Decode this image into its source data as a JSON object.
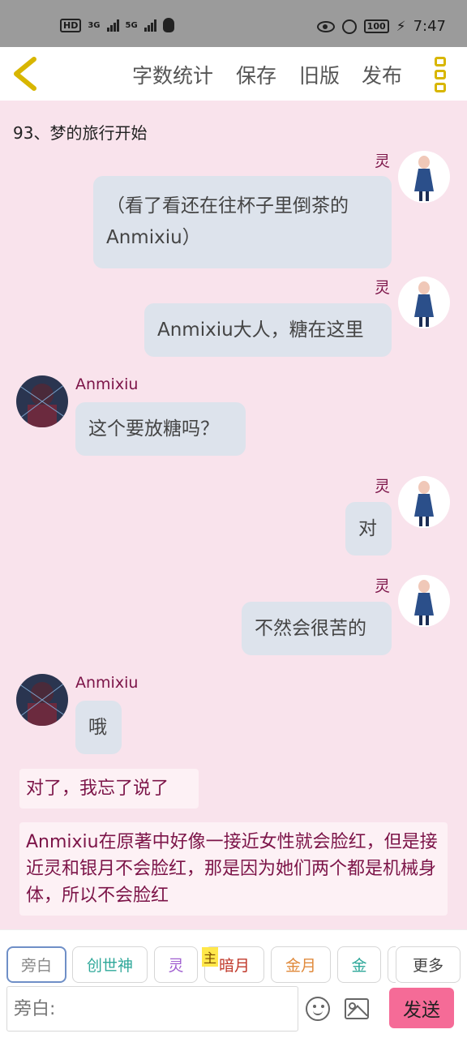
{
  "status_bar": {
    "hd_label": "HD",
    "sim1": "3G",
    "sim2": "5G",
    "battery": "100",
    "time": "7:47"
  },
  "toolbar": {
    "word_count": "字数统计",
    "save": "保存",
    "old_version": "旧版",
    "publish": "发布"
  },
  "chapter": {
    "title": "93、梦的旅行开始"
  },
  "messages": [
    {
      "speaker": "灵",
      "text": "（看了看还在往杯子里倒茶的Anmixiu）"
    },
    {
      "speaker": "灵",
      "text": "Anmixiu大人，糖在这里"
    },
    {
      "speaker": "Anmixiu",
      "text": "这个要放糖吗？"
    },
    {
      "speaker": "灵",
      "text": "对"
    },
    {
      "speaker": "灵",
      "text": "不然会很苦的"
    },
    {
      "speaker": "Anmixiu",
      "text": "哦"
    }
  ],
  "narrations": [
    "对了，我忘了说了",
    "Anmixiu在原著中好像一接近女性就会脸红，但是接近灵和银月不会脸红，那是因为她们两个都是机械身体，所以不会脸红"
  ],
  "character_chips": [
    {
      "label": "旁白",
      "color": "#888888"
    },
    {
      "label": "创世神",
      "color": "#2fa89a"
    },
    {
      "label": "灵",
      "color": "#a05fd0"
    },
    {
      "label": "暗月",
      "color": "#c0392b"
    },
    {
      "label": "金月",
      "color": "#e08a3c"
    },
    {
      "label": "金",
      "color": "#2fa89a"
    }
  ],
  "main_tag": "主",
  "more_button": "更多",
  "input": {
    "placeholder": "旁白:"
  },
  "send_button": "发送"
}
